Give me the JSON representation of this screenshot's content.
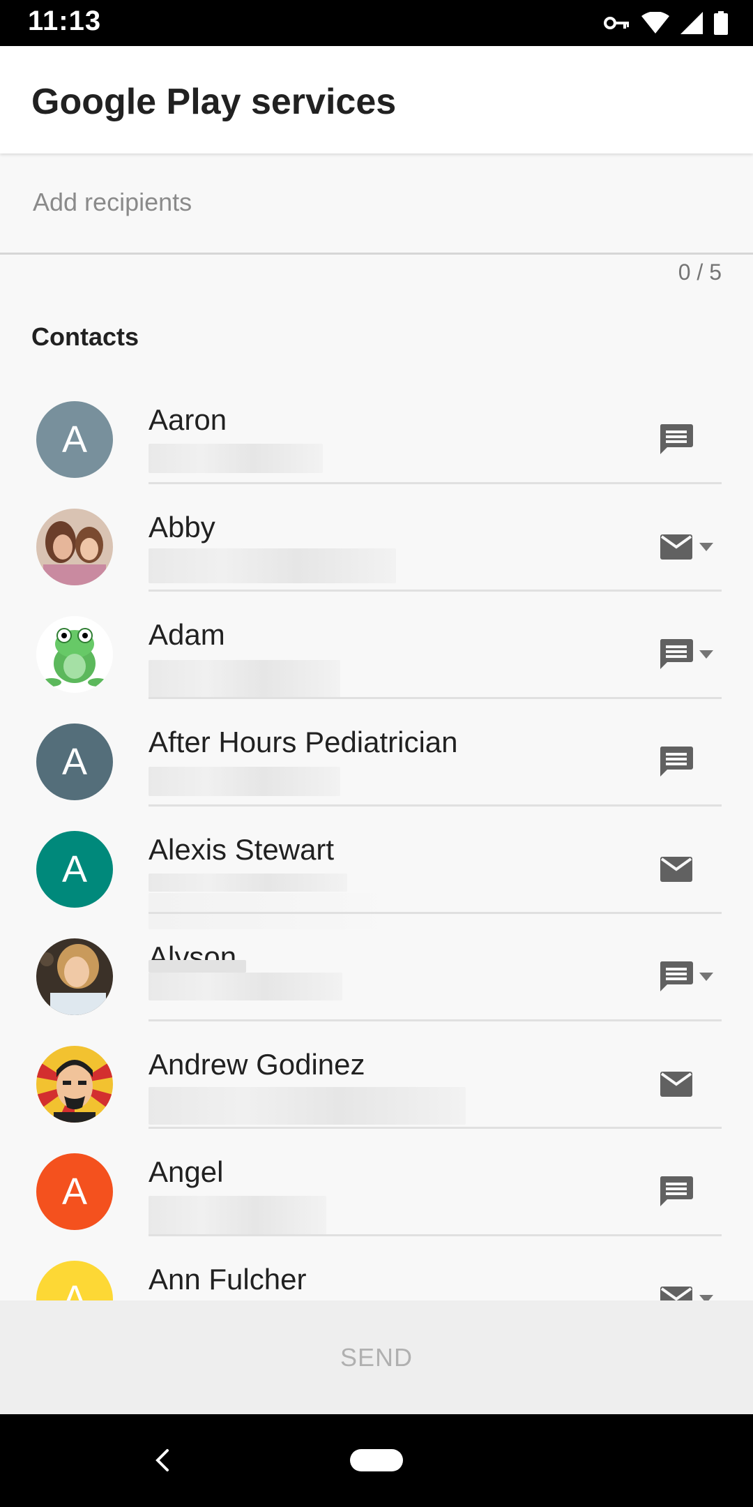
{
  "status_bar": {
    "time": "11:13",
    "icons": [
      "vpn-key-icon",
      "wifi-icon",
      "cell-signal-icon",
      "battery-icon"
    ]
  },
  "app_bar": {
    "title": "Google Play services"
  },
  "recipients": {
    "placeholder": "Add recipients",
    "value": "",
    "counter": "0 / 5"
  },
  "contacts_section": {
    "title": "Contacts"
  },
  "contacts": [
    {
      "name": "Aaron",
      "avatar_type": "letter",
      "initial": "A",
      "avatar_color": "#78909c",
      "action_icon": "message-icon",
      "has_dropdown": false
    },
    {
      "name": "Abby",
      "avatar_type": "photo",
      "avatar_color": "#a67c63",
      "action_icon": "email-icon",
      "has_dropdown": true
    },
    {
      "name": "Adam",
      "avatar_type": "photo",
      "avatar_color": "#4caf50",
      "action_icon": "message-icon",
      "has_dropdown": true
    },
    {
      "name": "After Hours Pediatrician",
      "avatar_type": "letter",
      "initial": "A",
      "avatar_color": "#546e7a",
      "action_icon": "message-icon",
      "has_dropdown": false
    },
    {
      "name": "Alexis Stewart",
      "avatar_type": "letter",
      "initial": "A",
      "avatar_color": "#00897b",
      "action_icon": "email-icon",
      "has_dropdown": false
    },
    {
      "name": "Alyson",
      "avatar_type": "photo",
      "avatar_color": "#6d5b4d",
      "action_icon": "message-icon",
      "has_dropdown": true
    },
    {
      "name": "Andrew Godinez",
      "avatar_type": "photo",
      "avatar_color": "#d32f2f",
      "action_icon": "email-icon",
      "has_dropdown": false
    },
    {
      "name": "Angel",
      "avatar_type": "letter",
      "initial": "A",
      "avatar_color": "#f4511e",
      "action_icon": "message-icon",
      "has_dropdown": false
    },
    {
      "name": "Ann Fulcher",
      "avatar_type": "letter",
      "initial": "A",
      "avatar_color": "#fdd835",
      "action_icon": "email-icon",
      "has_dropdown": true
    }
  ],
  "send_bar": {
    "label": "SEND"
  },
  "nav_bar": {
    "icons": [
      "back-icon",
      "home-pill-icon"
    ]
  }
}
